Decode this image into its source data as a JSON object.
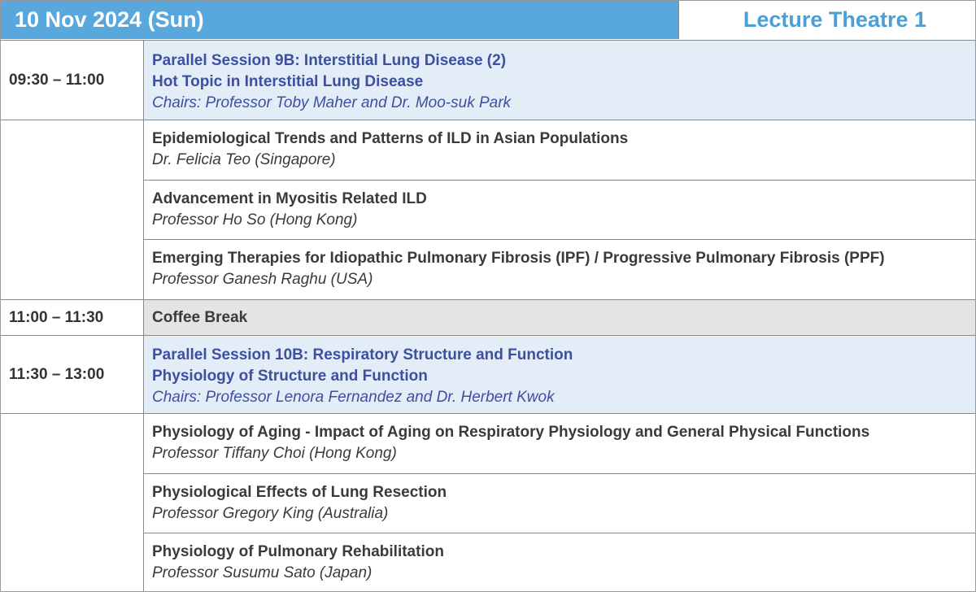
{
  "header": {
    "date": "10 Nov 2024 (Sun)",
    "venue": "Lecture Theatre 1"
  },
  "session1": {
    "time": "09:30 – 11:00",
    "line1": "Parallel Session 9B: Interstitial Lung Disease (2)",
    "line2": "Hot Topic in Interstitial Lung Disease",
    "chairs": "Chairs: Professor Toby Maher and Dr. Moo-suk Park",
    "talks": [
      {
        "title": "Epidemiological Trends and Patterns of ILD in Asian Populations",
        "speaker": "Dr. Felicia Teo (Singapore)"
      },
      {
        "title": "Advancement in Myositis Related ILD",
        "speaker": "Professor Ho So (Hong Kong)"
      },
      {
        "title": "Emerging Therapies for Idiopathic Pulmonary Fibrosis (IPF) / Progressive Pulmonary Fibrosis (PPF)",
        "speaker": "Professor Ganesh Raghu (USA)"
      }
    ]
  },
  "break": {
    "time": "11:00 – 11:30",
    "label": "Coffee Break"
  },
  "session2": {
    "time": "11:30 – 13:00",
    "line1": "Parallel Session 10B: Respiratory Structure and Function",
    "line2": "Physiology of Structure and Function",
    "chairs": "Chairs: Professor Lenora Fernandez and Dr. Herbert Kwok",
    "talks": [
      {
        "title": "Physiology of Aging - Impact of Aging on Respiratory Physiology and General Physical Functions",
        "speaker": "Professor Tiffany Choi (Hong Kong)"
      },
      {
        "title": "Physiological Effects of Lung Resection",
        "speaker": "Professor Gregory King (Australia)"
      },
      {
        "title": "Physiology of Pulmonary Rehabilitation",
        "speaker": "Professor Susumu Sato (Japan)"
      }
    ]
  }
}
